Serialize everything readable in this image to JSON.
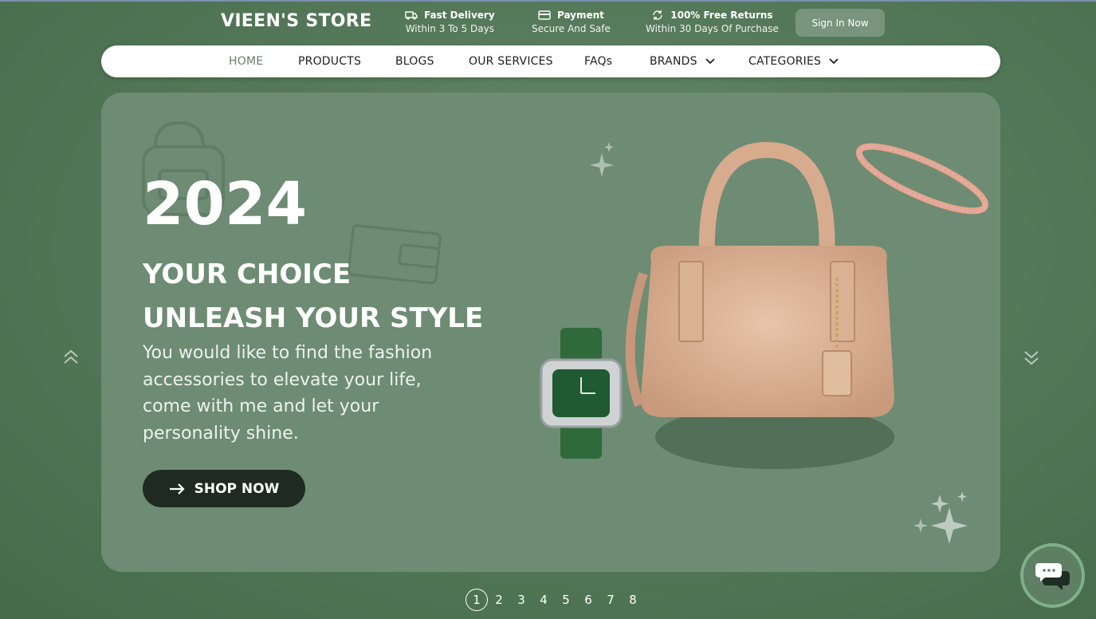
{
  "header": {
    "logo": "VIEEN'S STORE",
    "features": [
      {
        "icon": "truck-icon",
        "title": "Fast Delivery",
        "subtitle": "Within 3 To 5 Days"
      },
      {
        "icon": "credit-card-icon",
        "title": "Payment",
        "subtitle": "Secure And Safe"
      },
      {
        "icon": "return-icon",
        "title": "100% Free Returns",
        "subtitle": "Within 30 Days Of Purchase"
      }
    ],
    "signin_label": "Sign In Now"
  },
  "nav": {
    "items": [
      {
        "label": "HOME",
        "active": true,
        "dropdown": false
      },
      {
        "label": "PRODUCTS",
        "active": false,
        "dropdown": false
      },
      {
        "label": "BLOGS",
        "active": false,
        "dropdown": false
      },
      {
        "label": "OUR SERVICES",
        "active": false,
        "dropdown": false
      },
      {
        "label": "FAQs",
        "active": false,
        "dropdown": false
      },
      {
        "label": "BRANDS",
        "active": false,
        "dropdown": true
      },
      {
        "label": "CATEGORIES",
        "active": false,
        "dropdown": true
      }
    ]
  },
  "hero": {
    "year": "2024",
    "headline_1": "YOUR CHOICE",
    "headline_2": "UNLEASH YOUR STYLE",
    "description": "You would like to find the fashion accessories to elevate your life, come with me and let your personality shine.",
    "cta_label": "SHOP NOW"
  },
  "pagination": {
    "pages": [
      "1",
      "2",
      "3",
      "4",
      "5",
      "6",
      "7",
      "8"
    ],
    "current": "1"
  },
  "colors": {
    "background": "#55795a",
    "hero_card": "#6d8c73",
    "cta": "#1e2a22",
    "nav_bg": "#ffffff",
    "chat_ring": "#7fb08a"
  }
}
